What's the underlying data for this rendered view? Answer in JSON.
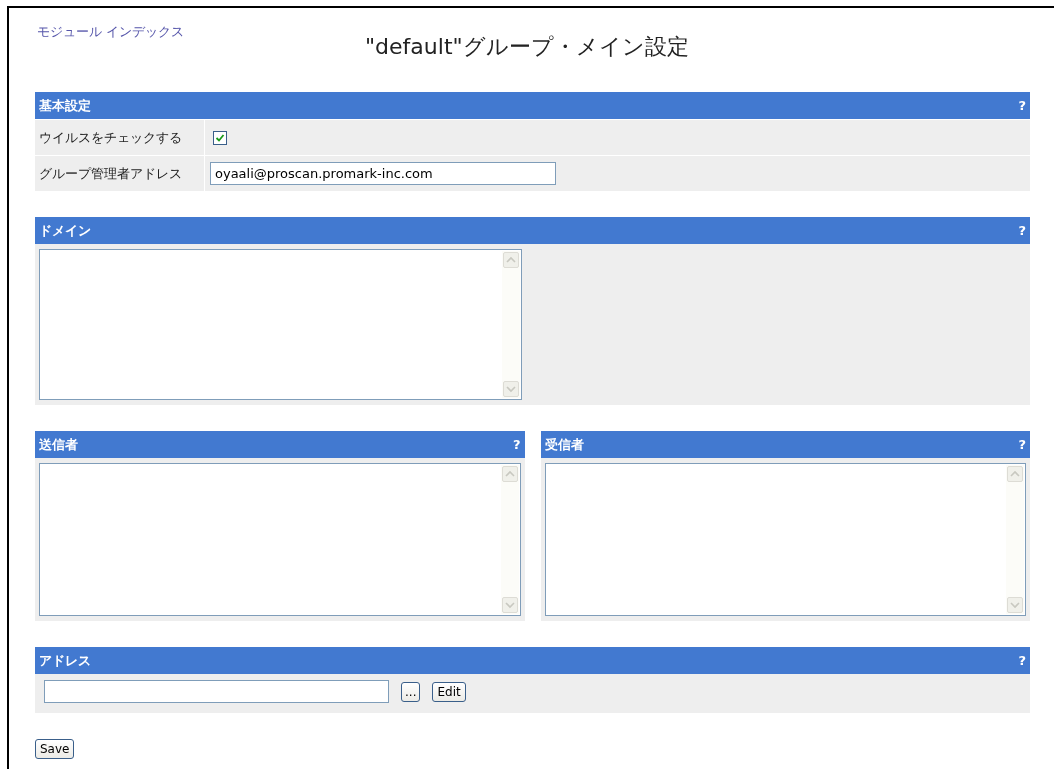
{
  "module_index_link": "モジュール インデックス",
  "heading": "\"default\"グループ・メイン設定",
  "basic": {
    "title": "基本設定",
    "help": "?",
    "rows": [
      {
        "kind": "checkbox",
        "label": "ウイルスをチェックする",
        "checked": true
      },
      {
        "kind": "text",
        "label": "グループ管理者アドレス",
        "value": "oyaali@proscan.promark-inc.com"
      }
    ]
  },
  "domain": {
    "title": "ドメイン",
    "help": "?"
  },
  "senders": {
    "title": "送信者",
    "help": "?"
  },
  "recipients": {
    "title": "受信者",
    "help": "?"
  },
  "address": {
    "title": "アドレス",
    "help": "?",
    "browse_button": "...",
    "edit_button": "Edit"
  },
  "save_button": "Save"
}
